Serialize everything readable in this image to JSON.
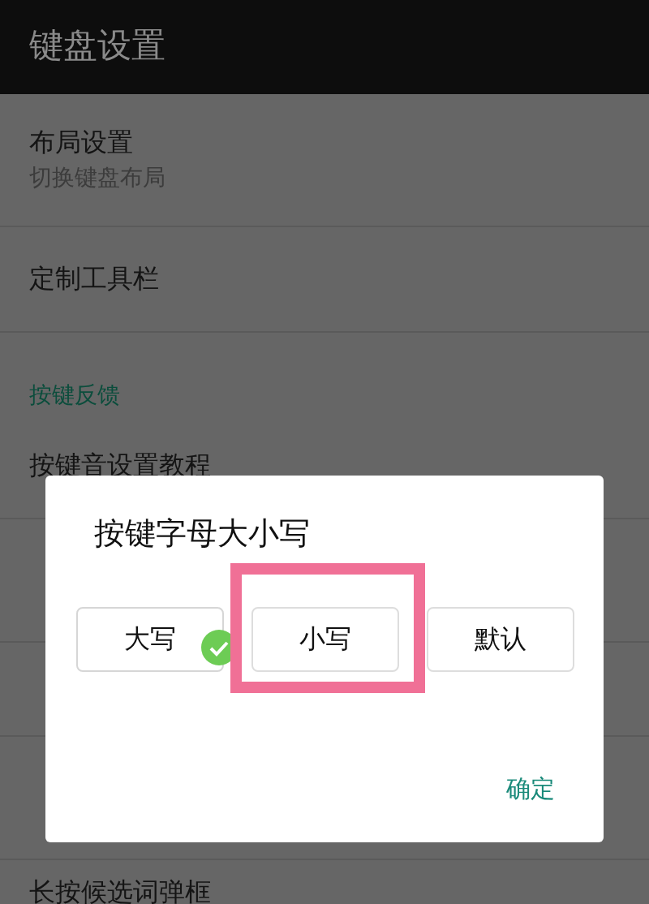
{
  "app_bar": {
    "title": "键盘设置"
  },
  "settings": [
    {
      "kind": "item",
      "title": "布局设置",
      "subtitle": "切换键盘布局"
    },
    {
      "kind": "item",
      "title": "定制工具栏"
    },
    {
      "kind": "header",
      "title": "按键反馈"
    },
    {
      "kind": "item",
      "title": "按键音设置教程"
    },
    {
      "kind": "covered"
    },
    {
      "kind": "covered_short"
    },
    {
      "kind": "covered"
    },
    {
      "kind": "last",
      "title": "长按候选词弹框"
    }
  ],
  "dialog": {
    "title": "按键字母大小写",
    "options": [
      {
        "label": "大写",
        "selected": true
      },
      {
        "label": "小写",
        "selected": false,
        "highlighted": true
      },
      {
        "label": "默认",
        "selected": false
      }
    ],
    "confirm": "确定"
  }
}
